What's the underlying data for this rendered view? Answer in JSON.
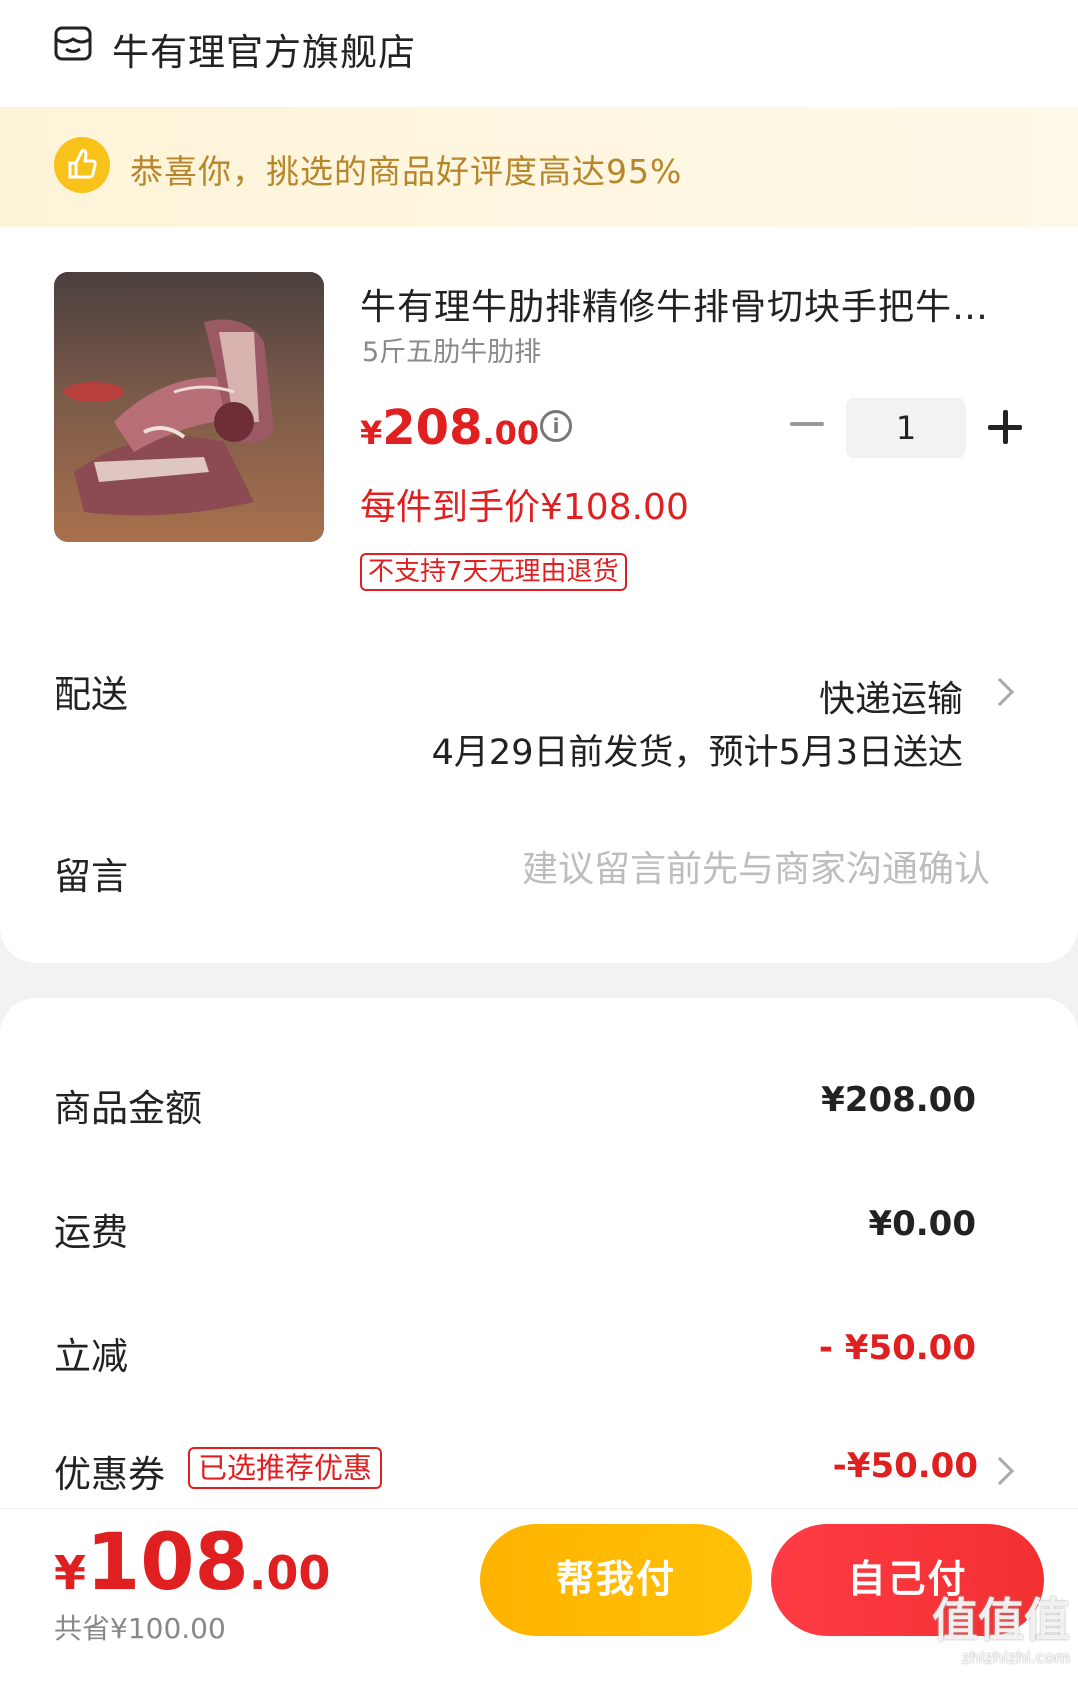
{
  "store": {
    "name": "牛有理官方旗舰店",
    "icon": "store-icon"
  },
  "banner": {
    "text": "恭喜你，挑选的商品好评度高达95%",
    "icon": "thumbs-up-icon"
  },
  "product": {
    "title": "牛有理牛肋排精修牛排骨切块手把牛…",
    "spec": "5斤五肋牛肋排",
    "price_yen": "¥",
    "price_int": "208",
    "price_dec": ".00",
    "final_price": "每件到手价¥108.00",
    "no_return_tag": "不支持7天无理由退货",
    "quantity": "1"
  },
  "delivery": {
    "label": "配送",
    "method": "快递运输",
    "date": "4月29日前发货，预计5月3日送达"
  },
  "message": {
    "label": "留言",
    "placeholder": "建议留言前先与商家沟通确认"
  },
  "summary": {
    "goods_label": "商品金额",
    "goods_value": "¥208.00",
    "shipping_label": "运费",
    "shipping_value": "¥0.00",
    "discount_label": "立减",
    "discount_value": "- ¥50.00",
    "coupon_label": "优惠券",
    "coupon_tag": "已选推荐优惠",
    "coupon_value": "-¥50.00"
  },
  "footer": {
    "total_yen": "¥",
    "total_int": "108",
    "total_dec": ".00",
    "saved": "共省¥100.00",
    "help_pay": "帮我付",
    "self_pay": "自己付"
  },
  "watermark": {
    "big": "值值值",
    "small": "zhizhizhi.com"
  },
  "colors": {
    "accent_red": "#e02020",
    "help_yellow": "#ffb300",
    "banner_text": "#b8862a"
  }
}
